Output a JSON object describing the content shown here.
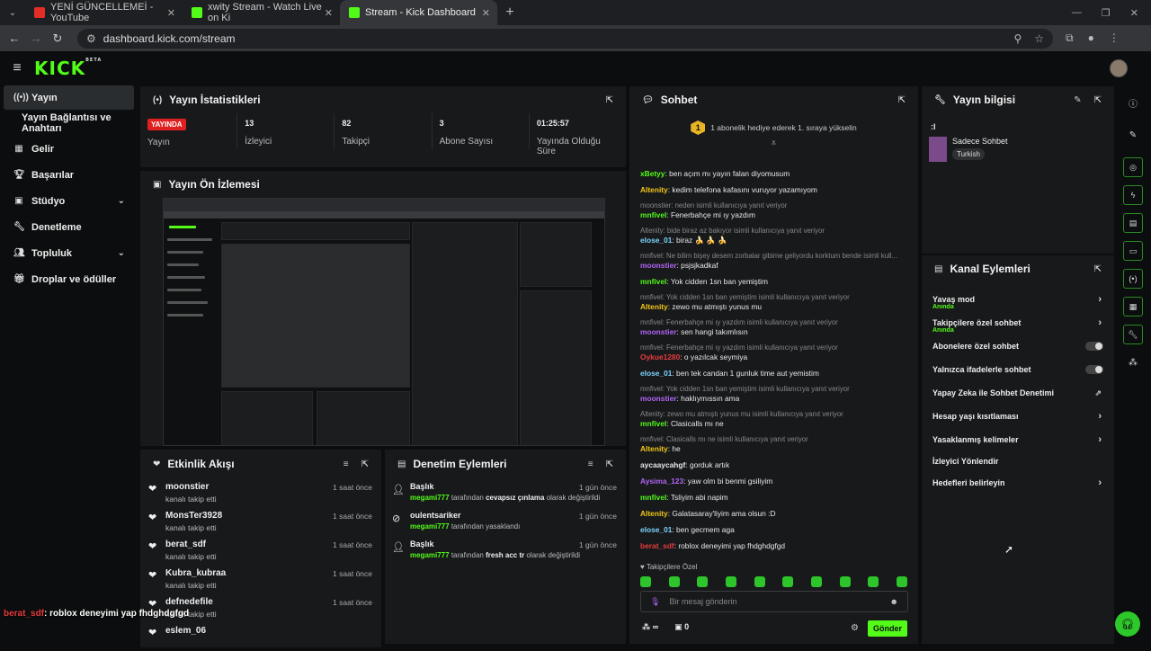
{
  "browser": {
    "tabs": [
      {
        "title": "YENİ GÜNCELLEMEİ - YouTube",
        "fav": "#e52d27"
      },
      {
        "title": "xwity Stream - Watch Live on Ki",
        "fav": "#53fc18"
      },
      {
        "title": "Stream - Kick Dashboard",
        "fav": "#53fc18"
      }
    ],
    "url": "dashboard.kick.com/stream"
  },
  "brand": {
    "logo": "KICK",
    "beta": "BETA"
  },
  "sidebar": {
    "items": [
      {
        "label": "Yayın",
        "icon": "broadcast-icon"
      },
      {
        "label": "Yayın Bağlantısı ve Anahtarı",
        "icon": ""
      },
      {
        "label": "Gelir",
        "icon": "money-icon"
      },
      {
        "label": "Başarılar",
        "icon": "trophy-icon"
      },
      {
        "label": "Stüdyo",
        "icon": "studio-icon"
      },
      {
        "label": "Denetleme",
        "icon": "wrench-icon"
      },
      {
        "label": "Topluluk",
        "icon": "people-icon"
      },
      {
        "label": "Droplar ve ödüller",
        "icon": "gift-icon"
      }
    ]
  },
  "stats_panel": {
    "title": "Yayın İstatistikleri",
    "live_badge": "YAYINDA",
    "stats": [
      {
        "value": "",
        "label": "Yayın"
      },
      {
        "value": "13",
        "label": "İzleyici"
      },
      {
        "value": "82",
        "label": "Takipçi"
      },
      {
        "value": "3",
        "label": "Abone Sayısı"
      },
      {
        "value": "01:25:57",
        "label": "Yayında Olduğu Süre"
      }
    ]
  },
  "preview_panel": {
    "title": "Yayın Ön İzlemesi"
  },
  "activity": {
    "title": "Etkinlik Akışı",
    "items": [
      {
        "name": "moonstier",
        "desc": "kanalı takip etti",
        "time": "1 saat önce"
      },
      {
        "name": "MonsTer3928",
        "desc": "kanalı takip etti",
        "time": "1 saat önce"
      },
      {
        "name": "berat_sdf",
        "desc": "kanalı takip etti",
        "time": "1 saat önce"
      },
      {
        "name": "Kubra_kubraa",
        "desc": "kanalı takip etti",
        "time": "1 saat önce"
      },
      {
        "name": "defnedefile",
        "desc": "kanalı takip etti",
        "time": "1 saat önce"
      },
      {
        "name": "eslem_06",
        "desc": "",
        "time": ""
      }
    ]
  },
  "moderation": {
    "title": "Denetim Eylemleri",
    "items": [
      {
        "title": "Başlık",
        "user": "megami777",
        "pre": "tarafından",
        "bold": "cevapsız çınlama",
        "post": "olarak değiştirildi",
        "time": "1 gün önce",
        "icon": "user-edit-icon"
      },
      {
        "title": "oulentsariker",
        "user": "megami777",
        "pre": "tarafından yasaklandı",
        "bold": "",
        "post": "",
        "time": "1 gün önce",
        "icon": "ban-icon"
      },
      {
        "title": "Başlık",
        "user": "megami777",
        "pre": "tarafından",
        "bold": "fresh acc tr",
        "post": "olarak değiştirildi",
        "time": "1 gün önce",
        "icon": "user-edit-icon"
      }
    ]
  },
  "chat": {
    "title": "Sohbet",
    "gift_rank": "1",
    "gift_text": "1 abonelik hediye ederek 1. sıraya yükselin",
    "messages": [
      {
        "reply": "",
        "user": "xBetyy",
        "color": "#53fc18",
        "text": "ben açım mı yayın falan diyomusum"
      },
      {
        "reply": "",
        "user": "Altenity",
        "color": "#f2c618",
        "text": "kedim telefona kafasını vuruyor yazamıyom"
      },
      {
        "reply": "moonstier: neden isimli kullanıcıya yanıt veriyor",
        "user": "mnfivel",
        "color": "#53fc18",
        "text": "Fenerbahçe mi ıy yazdım"
      },
      {
        "reply": "Altenity: bide biraz az bakıyor isimli kullanıcıya yanıt veriyor",
        "user": "elose_01",
        "color": "#7dd3fc",
        "text": "biraz 🍌 🍌 🍌"
      },
      {
        "reply": "mnfivel: Ne bilim bişey desem zorbalar gibime geliyordu korktum bende isimli kull...",
        "user": "moonstier",
        "color": "#b065f5",
        "text": "psjsjkadkaf"
      },
      {
        "reply": "",
        "user": "mnfivel",
        "color": "#53fc18",
        "text": "Yok cidden 1sn ban yemiştim"
      },
      {
        "reply": "mnfivel: Yok cidden 1sn ban yemiştim isimli kullanıcıya yanıt veriyor",
        "user": "Altenity",
        "color": "#f2c618",
        "text": "zewo mu atmıştı yunus mu"
      },
      {
        "reply": "mnfivel: Fenerbahçe mi ıy yazdım isimli kullanıcıya yanıt veriyor",
        "user": "moonstier",
        "color": "#b065f5",
        "text": "sen hangi takımlısın"
      },
      {
        "reply": "mnfivel: Fenerbahçe mi ıy yazdım isimli kullanıcıya yanıt veriyor",
        "user": "Oykue1280",
        "color": "#e63c3c",
        "text": "o yazılcak seymiya"
      },
      {
        "reply": "",
        "user": "elose_01",
        "color": "#7dd3fc",
        "text": "ben tek candan 1 gunluk time aut yemistim"
      },
      {
        "reply": "mnfivel: Yok cidden 1sn ban yemiştim isimli kullanıcıya yanıt veriyor",
        "user": "moonstier",
        "color": "#b065f5",
        "text": "haklıymıssın ama"
      },
      {
        "reply": "Altenity: zewo mu atmıştı yunus mu isimli kullanıcıya yanıt veriyor",
        "user": "mnfivel",
        "color": "#53fc18",
        "text": "Clasicalls mı ne"
      },
      {
        "reply": "mnfivel: Clasicalls mı ne isimli kullanıcıya yanıt veriyor",
        "user": "Altenity",
        "color": "#f2c618",
        "text": "he"
      },
      {
        "reply": "",
        "user": "aycaaycahgf",
        "color": "#e8e8e8",
        "text": "gorduk artık"
      },
      {
        "reply": "",
        "user": "Aysima_123",
        "color": "#b065f5",
        "text": "yaw olm bi benmi gsiliyim"
      },
      {
        "reply": "",
        "user": "mnfivel",
        "color": "#53fc18",
        "text": "Tsliyim abi napim"
      },
      {
        "reply": "",
        "user": "Altenity",
        "color": "#f2c618",
        "text": "Galatasaray'liyim ama olsun :D"
      },
      {
        "reply": "",
        "user": "elose_01",
        "color": "#7dd3fc",
        "text": "ben gecmem aga"
      },
      {
        "reply": "",
        "user": "berat_sdf",
        "color": "#e63c3c",
        "text": "roblox deneyimi yap fhdghdgfgd"
      }
    ],
    "followers_only": "Takipçilere Özel",
    "placeholder": "Bir mesaj gönderin",
    "points_value": "0",
    "send_label": "Gönder",
    "infinity": "∞"
  },
  "stream_info": {
    "title": "Yayın bilgisi",
    "stream_title": ":I",
    "category": "Sadece Sohbet",
    "tag": "Turkish"
  },
  "channel_actions": {
    "title": "Kanal Eylemleri",
    "items": [
      {
        "label": "Yavaş mod",
        "sub": "Anında",
        "control": "arrow"
      },
      {
        "label": "Takipçilere özel sohbet",
        "sub": "Anında",
        "control": "arrow"
      },
      {
        "label": "Abonelere özel sohbet",
        "sub": "",
        "control": "toggle"
      },
      {
        "label": "Yalnızca ifadelerle sohbet",
        "sub": "",
        "control": "toggle"
      },
      {
        "label": "Yapay Zeka ile Sohbet Denetimi",
        "sub": "",
        "control": "external"
      },
      {
        "label": "Hesap yaşı kısıtlaması",
        "sub": "",
        "control": "arrow"
      },
      {
        "label": "Yasaklanmış kelimeler",
        "sub": "",
        "control": "arrow"
      },
      {
        "label": "İzleyici Yönlendir",
        "sub": "",
        "control": "none"
      },
      {
        "label": "Hedefleri belirleyin",
        "sub": "",
        "control": "arrow"
      }
    ]
  },
  "overlay": {
    "user": "berat_sdf",
    "text": ": roblox deneyimi yap fhdghdgfgd"
  },
  "colors": {
    "accent": "#53fc18",
    "live": "#e02020",
    "panel": "#18191b",
    "bg": "#0b0d0e"
  }
}
